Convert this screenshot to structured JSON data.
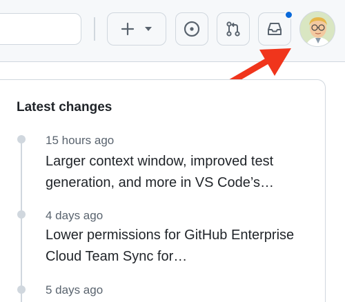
{
  "header": {
    "create_button": {
      "icon": "plus-icon",
      "dropdown_icon": "triangle-down-icon"
    },
    "issues_button": {
      "icon": "issue-opened-icon"
    },
    "pulls_button": {
      "icon": "git-pull-request-icon"
    },
    "inbox_button": {
      "icon": "inbox-icon",
      "has_unread": true
    },
    "avatar": {
      "icon": "user-avatar"
    },
    "colors": {
      "accent": "#0969da",
      "annotation_arrow": "#f0351c"
    }
  },
  "latest_changes": {
    "title": "Latest changes",
    "items": [
      {
        "time": "15 hours ago",
        "text": "Larger context window, improved test generation, and more in VS Code’s…"
      },
      {
        "time": "4 days ago",
        "text": "Lower permissions for GitHub Enterprise Cloud Team Sync for…"
      },
      {
        "time": "5 days ago",
        "text": ""
      }
    ]
  }
}
